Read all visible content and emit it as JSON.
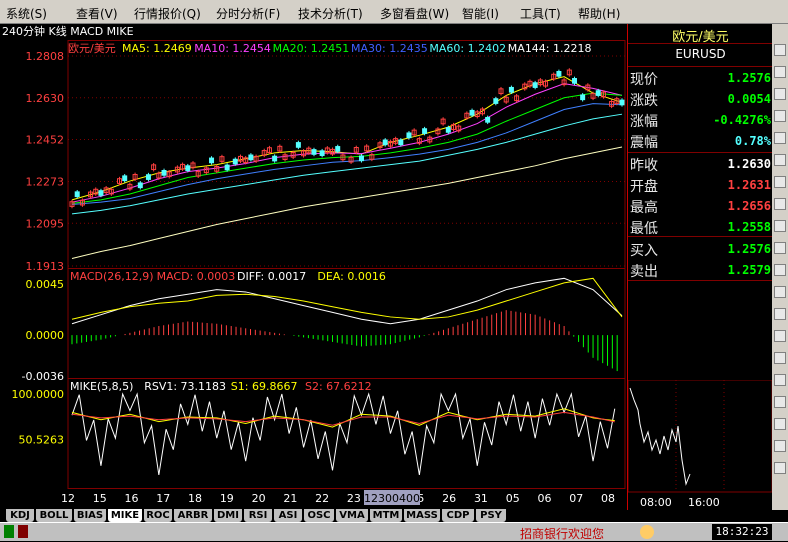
{
  "menu": [
    "系统(S)",
    "查看(V)",
    "行情报价(Q)",
    "分时分析(F)",
    "技术分析(T)",
    "多窗看盘(W)",
    "智能(I)",
    "工具(T)",
    "帮助(H)"
  ],
  "title_bar": "240分钟 K线 MACD MIKE",
  "colors": {
    "up": "#ff4040",
    "down": "#54ffff",
    "ma5": "#ffff00",
    "ma10": "#ff40ff",
    "ma20": "#00ff00",
    "ma30": "#4080ff",
    "ma60": "#54ffff",
    "ma144": "#ffffc0",
    "grid": "#800000",
    "macd_pos": "#ff4040",
    "macd_neg": "#00ff00",
    "diff": "#ffffff",
    "dea": "#ffff00"
  },
  "kline": {
    "symbol": "欧元/美元",
    "legend": [
      {
        "label": "MA5: 1.2469",
        "color": "#ffff00"
      },
      {
        "label": "MA10: 1.2454",
        "color": "#ff40ff"
      },
      {
        "label": "MA20: 1.2451",
        "color": "#00ff00"
      },
      {
        "label": "MA30: 1.2435",
        "color": "#4060ff"
      },
      {
        "label": "MA60: 1.2402",
        "color": "#54ffff"
      },
      {
        "label": "MA144: 1.2218",
        "color": "#ffffff"
      }
    ],
    "yticks": [
      "1.2808",
      "1.2630",
      "1.2452",
      "1.2273",
      "1.2095",
      "1.1913"
    ],
    "ylim": [
      1.1913,
      1.2808
    ]
  },
  "macd": {
    "legend": [
      {
        "label": "MACD(26,12,9)",
        "color": "#ff4040"
      },
      {
        "label": "MACD: 0.0003",
        "color": "#ff4040"
      },
      {
        "label": "DIFF: 0.0017",
        "color": "#ffffff"
      },
      {
        "label": "DEA: 0.0016",
        "color": "#ffff00"
      }
    ],
    "yticks": [
      "0.0045",
      "0.0000",
      "-0.0036"
    ]
  },
  "mike": {
    "legend": [
      {
        "label": "MIKE(5,8,5)",
        "color": "#ffffff"
      },
      {
        "label": "RSV1: 73.1183",
        "color": "#ffffff"
      },
      {
        "label": "S1: 69.8667",
        "color": "#ffff00"
      },
      {
        "label": "S2: 67.6212",
        "color": "#ff4040"
      }
    ],
    "yticks": [
      "100.0000",
      "50.5263"
    ]
  },
  "xaxis": {
    "labels": [
      "12",
      "15",
      "16",
      "17",
      "18",
      "19",
      "20",
      "21",
      "22",
      "23",
      "24",
      "25",
      "26",
      "31",
      "05",
      "06",
      "07",
      "08"
    ],
    "cursor_label": "12300400"
  },
  "tabs": [
    "KDJ",
    "BOLL",
    "BIAS",
    "MIKE",
    "ROC",
    "ARBR",
    "DMI",
    "RSI",
    "ASI",
    "OSC",
    "VMA",
    "MTM",
    "MASS",
    "CDP",
    "PSY"
  ],
  "active_tab": "MIKE",
  "quote": {
    "name": "欧元/美元",
    "code": "EURUSD",
    "rows": [
      {
        "label": "现价",
        "value": "1.2576",
        "color": "#00ff00"
      },
      {
        "label": "涨跌",
        "value": "0.0054",
        "color": "#00ff00"
      },
      {
        "label": "涨幅",
        "value": "-0.4276%",
        "color": "#00ff00"
      },
      {
        "label": "震幅",
        "value": "0.78%",
        "color": "#54ffff"
      },
      {
        "label": "昨收",
        "value": "1.2630",
        "color": "#ffffff"
      },
      {
        "label": "开盘",
        "value": "1.2631",
        "color": "#ff4040"
      },
      {
        "label": "最高",
        "value": "1.2656",
        "color": "#ff4040"
      },
      {
        "label": "最低",
        "value": "1.2558",
        "color": "#00ff00"
      },
      {
        "label": "买入",
        "value": "1.2576",
        "color": "#00ff00"
      },
      {
        "label": "卖出",
        "value": "1.2579",
        "color": "#00ff00"
      }
    ],
    "mini_chart_times": [
      "08:00",
      "16:00"
    ]
  },
  "status": {
    "marquee": "招商银行欢迎您",
    "time": "18:32:23"
  },
  "chart_data": [
    {
      "type": "line",
      "title": "欧元/美元",
      "series": [
        {
          "name": "MA5",
          "values": [
            1.2195,
            1.223,
            1.2275,
            1.231,
            1.233,
            1.2345,
            1.237,
            1.2395,
            1.2405,
            1.24,
            1.239,
            1.244,
            1.247,
            1.2505,
            1.256,
            1.264,
            1.269,
            1.272,
            1.265,
            1.261
          ]
        },
        {
          "name": "MA10",
          "values": [
            1.2185,
            1.221,
            1.2245,
            1.2285,
            1.2315,
            1.233,
            1.235,
            1.2375,
            1.239,
            1.2395,
            1.2392,
            1.2415,
            1.244,
            1.2475,
            1.252,
            1.259,
            1.2645,
            1.269,
            1.267,
            1.264
          ]
        },
        {
          "name": "MA20",
          "values": [
            1.218,
            1.2195,
            1.222,
            1.2255,
            1.229,
            1.231,
            1.233,
            1.235,
            1.2365,
            1.2375,
            1.238,
            1.2395,
            1.2415,
            1.244,
            1.2475,
            1.253,
            1.258,
            1.263,
            1.265,
            1.264
          ]
        },
        {
          "name": "MA30",
          "values": [
            1.2175,
            1.2185,
            1.22,
            1.223,
            1.226,
            1.2285,
            1.2305,
            1.2325,
            1.234,
            1.2355,
            1.2362,
            1.2375,
            1.239,
            1.241,
            1.244,
            1.248,
            1.253,
            1.258,
            1.2605,
            1.26
          ]
        },
        {
          "name": "MA60",
          "values": [
            1.2135,
            1.215,
            1.217,
            1.2195,
            1.222,
            1.224,
            1.226,
            1.228,
            1.23,
            1.2315,
            1.233,
            1.2345,
            1.236,
            1.2385,
            1.241,
            1.244,
            1.2475,
            1.251,
            1.254,
            1.256
          ]
        },
        {
          "name": "MA144",
          "values": [
            1.1945,
            1.1975,
            1.2,
            1.203,
            1.206,
            1.209,
            1.2115,
            1.214,
            1.2165,
            1.2185,
            1.2205,
            1.2225,
            1.2245,
            1.2265,
            1.229,
            1.2315,
            1.234,
            1.237,
            1.2395,
            1.242
          ]
        }
      ],
      "ylim": [
        1.1913,
        1.2808
      ]
    },
    {
      "type": "bar",
      "title": "MACD(26,12,9)",
      "series": [
        {
          "name": "MACD",
          "values": [
            -0.0008,
            -0.0004,
            0.0002,
            0.0008,
            0.0012,
            0.001,
            0.0006,
            0.0002,
            -0.0002,
            -0.0006,
            -0.001,
            -0.0008,
            -0.0002,
            0.0006,
            0.0014,
            0.0022,
            0.0018,
            0.0008,
            -0.002,
            -0.0034
          ]
        },
        {
          "name": "DIFF",
          "values": [
            0.001,
            0.0018,
            0.0026,
            0.0032,
            0.0036,
            0.004,
            0.0038,
            0.0032,
            0.0026,
            0.002,
            0.0014,
            0.001,
            0.0014,
            0.0022,
            0.003,
            0.004,
            0.0046,
            0.005,
            0.004,
            0.0017
          ]
        },
        {
          "name": "DEA",
          "values": [
            0.0014,
            0.002,
            0.0025,
            0.0028,
            0.003,
            0.0035,
            0.0036,
            0.0034,
            0.003,
            0.0025,
            0.002,
            0.0016,
            0.0014,
            0.0016,
            0.0022,
            0.003,
            0.0038,
            0.0046,
            0.005,
            0.0016
          ]
        }
      ],
      "ylim": [
        -0.0036,
        0.0045
      ]
    },
    {
      "type": "line",
      "title": "MIKE(5,8,5)",
      "series": [
        {
          "name": "RSV1",
          "values": [
            95,
            40,
            100,
            30,
            85,
            70,
            45,
            90,
            60,
            35,
            95,
            75,
            30,
            100,
            40,
            85,
            70,
            98,
            45,
            73
          ]
        },
        {
          "name": "S1",
          "values": [
            80,
            72,
            78,
            70,
            75,
            74,
            68,
            76,
            72,
            64,
            78,
            76,
            66,
            80,
            72,
            78,
            76,
            84,
            74,
            70
          ]
        },
        {
          "name": "S2",
          "values": [
            78,
            74,
            76,
            72,
            74,
            73,
            70,
            74,
            72,
            66,
            75,
            75,
            68,
            77,
            73,
            76,
            75,
            80,
            75,
            68
          ]
        }
      ],
      "ylim": [
        0,
        100
      ]
    }
  ]
}
